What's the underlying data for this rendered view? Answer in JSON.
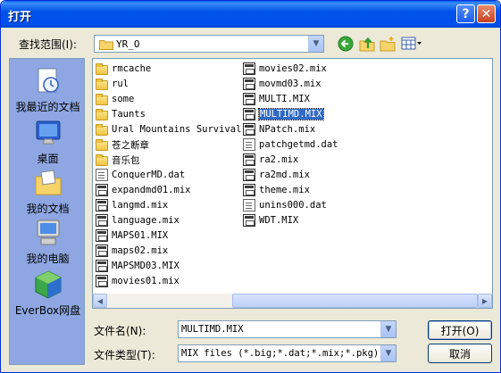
{
  "window": {
    "title": "打开",
    "help_glyph": "?",
    "close_glyph": "✕"
  },
  "lookin": {
    "label": "查找范围(I):",
    "value": "YR_O"
  },
  "toolbar": {
    "back_icon": "back-icon",
    "up_icon": "up-folder-icon",
    "new_folder_icon": "new-folder-icon",
    "views_icon": "views-menu-icon"
  },
  "places": [
    {
      "label": "我最近的文档",
      "icon": "recent-documents-icon"
    },
    {
      "label": "桌面",
      "icon": "desktop-icon"
    },
    {
      "label": "我的文档",
      "icon": "my-documents-icon"
    },
    {
      "label": "我的电脑",
      "icon": "my-computer-icon"
    },
    {
      "label": "EverBox网盘",
      "icon": "everbox-icon"
    }
  ],
  "files_col1": [
    {
      "name": "rmcache",
      "kind": "folder"
    },
    {
      "name": "rul",
      "kind": "folder"
    },
    {
      "name": "some",
      "kind": "folder"
    },
    {
      "name": "Taunts",
      "kind": "folder"
    },
    {
      "name": "Ural Mountains Survival",
      "kind": "folder"
    },
    {
      "name": "苍之断章",
      "kind": "folder"
    },
    {
      "name": "音乐包",
      "kind": "folder"
    },
    {
      "name": "ConquerMD.dat",
      "kind": "doc"
    },
    {
      "name": "expandmd01.mix",
      "kind": "mix"
    },
    {
      "name": "langmd.mix",
      "kind": "mix"
    },
    {
      "name": "language.mix",
      "kind": "mix"
    },
    {
      "name": "MAPS01.MIX",
      "kind": "mix"
    },
    {
      "name": "maps02.mix",
      "kind": "mix"
    },
    {
      "name": "MAPSMD03.MIX",
      "kind": "mix"
    },
    {
      "name": "movies01.mix",
      "kind": "mix"
    }
  ],
  "files_col2": [
    {
      "name": "movies02.mix",
      "kind": "mix"
    },
    {
      "name": "movmd03.mix",
      "kind": "mix"
    },
    {
      "name": "MULTI.MIX",
      "kind": "mix"
    },
    {
      "name": "MULTIMD.MIX",
      "kind": "mix",
      "selected": true
    },
    {
      "name": "NPatch.mix",
      "kind": "mix"
    },
    {
      "name": "patchgetmd.dat",
      "kind": "doc"
    },
    {
      "name": "ra2.mix",
      "kind": "mix"
    },
    {
      "name": "ra2md.mix",
      "kind": "mix"
    },
    {
      "name": "theme.mix",
      "kind": "mix"
    },
    {
      "name": "unins000.dat",
      "kind": "doc"
    },
    {
      "name": "WDT.MIX",
      "kind": "mix"
    }
  ],
  "filename": {
    "label": "文件名(N):",
    "value": "MULTIMD.MIX"
  },
  "filetype": {
    "label": "文件类型(T):",
    "value": "MIX files (*.big;*.dat;*.mix;*.pkg)"
  },
  "buttons": {
    "open": "打开(O)",
    "cancel": "取消"
  },
  "colors": {
    "titlebar": "#0053e9",
    "selection": "#316ac5",
    "places_bar": "#8ea7e2"
  }
}
